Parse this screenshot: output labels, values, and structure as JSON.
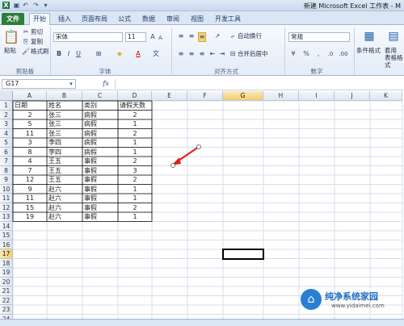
{
  "window": {
    "title": "新建 Microsoft Excel 工作表 - M"
  },
  "quick_access": {
    "save_icon": "save-icon",
    "undo_icon": "undo-icon",
    "redo_icon": "redo-icon"
  },
  "ribbon_tabs": [
    "文件",
    "开始",
    "插入",
    "页面布局",
    "公式",
    "数据",
    "审阅",
    "视图",
    "开发工具"
  ],
  "ribbon": {
    "paste": "粘贴",
    "cut": "剪切",
    "copy": "复制",
    "format_painter": "格式刷",
    "clipboard_group": "剪贴板",
    "font_name": "宋体",
    "font_size": "11",
    "font_group": "字体",
    "wrap_text": "自动换行",
    "merge_center": "合并后居中",
    "align_group": "对齐方式",
    "number_format": "常规",
    "number_group": "数字",
    "conditional_format": "条件格式",
    "table_format": "套用\n表格格式"
  },
  "formula_bar": {
    "name_box": "G17",
    "fx": "fx",
    "content": ""
  },
  "columns": [
    "A",
    "B",
    "C",
    "D",
    "E",
    "F",
    "G",
    "H",
    "I",
    "J",
    "K"
  ],
  "selected_column": "G",
  "selected_row": 17,
  "headers": [
    "日期",
    "姓名",
    "类别",
    "请假天数"
  ],
  "rows": [
    [
      "2",
      "张三",
      "病假",
      "2"
    ],
    [
      "5",
      "张三",
      "病假",
      "1"
    ],
    [
      "11",
      "张三",
      "病假",
      "2"
    ],
    [
      "3",
      "李四",
      "病假",
      "1"
    ],
    [
      "8",
      "李四",
      "病假",
      "1"
    ],
    [
      "4",
      "王五",
      "事假",
      "2"
    ],
    [
      "7",
      "王五",
      "事假",
      "3"
    ],
    [
      "12",
      "王五",
      "事假",
      "2"
    ],
    [
      "9",
      "赵六",
      "事假",
      "1"
    ],
    [
      "11",
      "赵六",
      "事假",
      "1"
    ],
    [
      "15",
      "赵六",
      "事假",
      "2"
    ],
    [
      "19",
      "赵六",
      "事假",
      "1"
    ]
  ],
  "row_numbers": [
    "1",
    "2",
    "3",
    "4",
    "5",
    "6",
    "7",
    "8",
    "9",
    "10",
    "11",
    "12",
    "13",
    "14",
    "15",
    "16",
    "17",
    "18",
    "19",
    "20",
    "21",
    "22",
    "23",
    "24"
  ],
  "annotation": {
    "arrow_color": "#e02020"
  },
  "watermark": {
    "text": "纯净系统家园",
    "url": "www.yidaimei.com"
  }
}
